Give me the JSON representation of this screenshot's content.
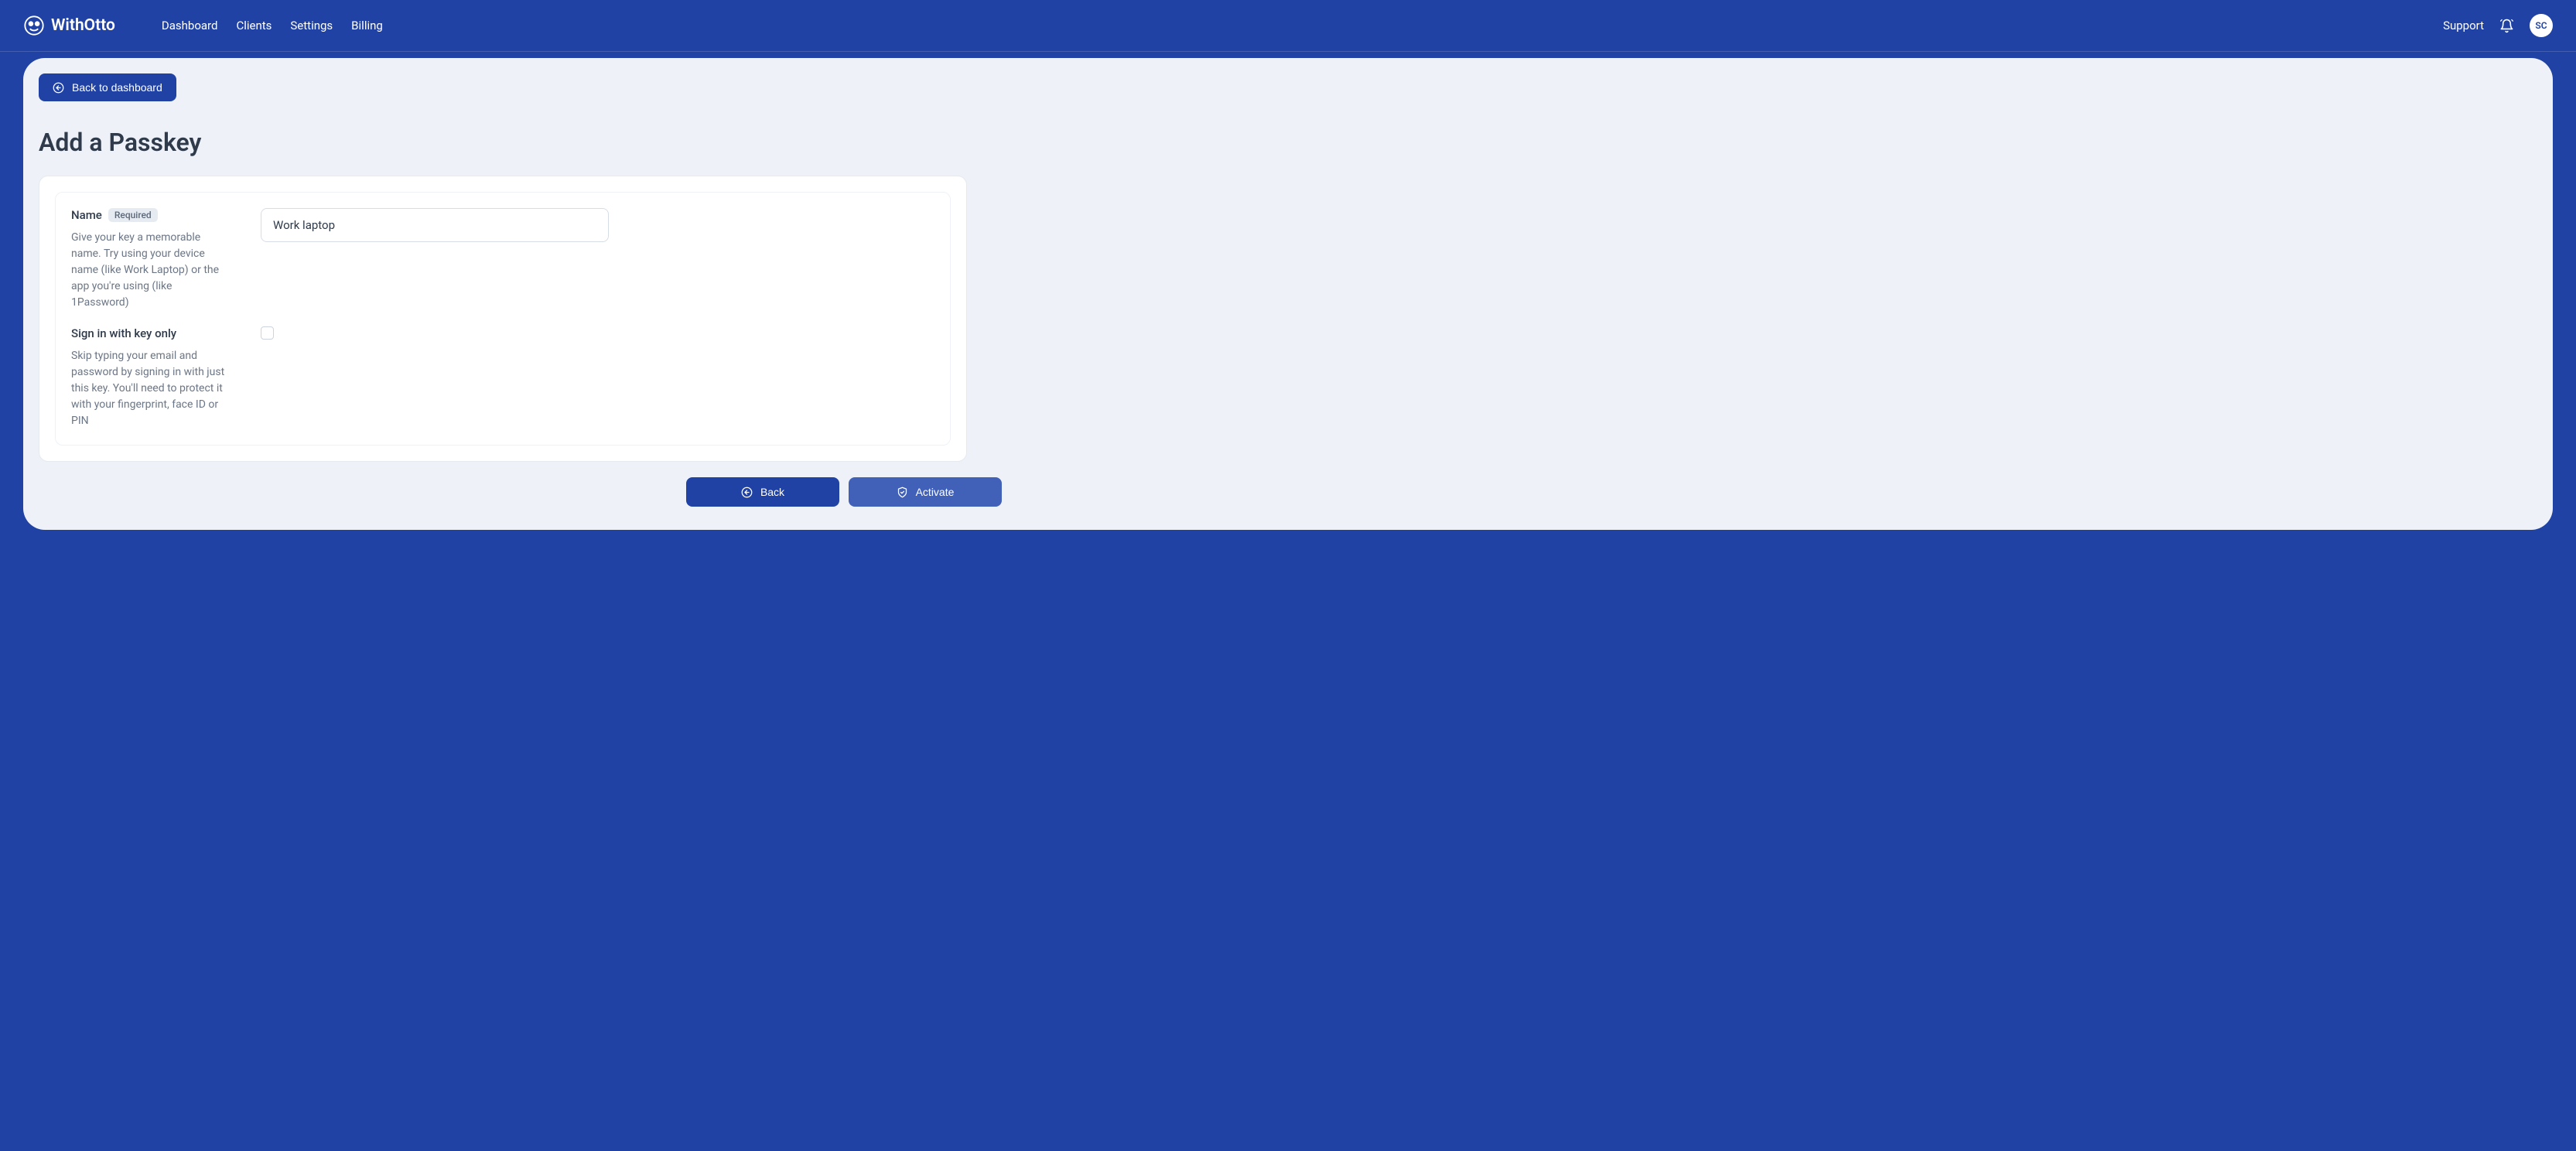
{
  "brand": {
    "name": "WithOtto"
  },
  "nav": {
    "items": [
      {
        "label": "Dashboard"
      },
      {
        "label": "Clients"
      },
      {
        "label": "Settings"
      },
      {
        "label": "Billing"
      }
    ],
    "support": "Support",
    "avatar_initials": "SC"
  },
  "page": {
    "back_button": "Back to dashboard",
    "title": "Add a Passkey"
  },
  "form": {
    "name": {
      "label": "Name",
      "required_badge": "Required",
      "help": "Give your key a memorable name. Try using your device name (like Work Laptop) or the app you're using (like 1Password)",
      "value": "Work laptop"
    },
    "key_only": {
      "label": "Sign in with key only",
      "help": "Skip typing your email and password by signing in with just this key. You'll need to protect it with your fingerprint, face ID or PIN",
      "checked": false
    }
  },
  "actions": {
    "back": "Back",
    "activate": "Activate"
  }
}
